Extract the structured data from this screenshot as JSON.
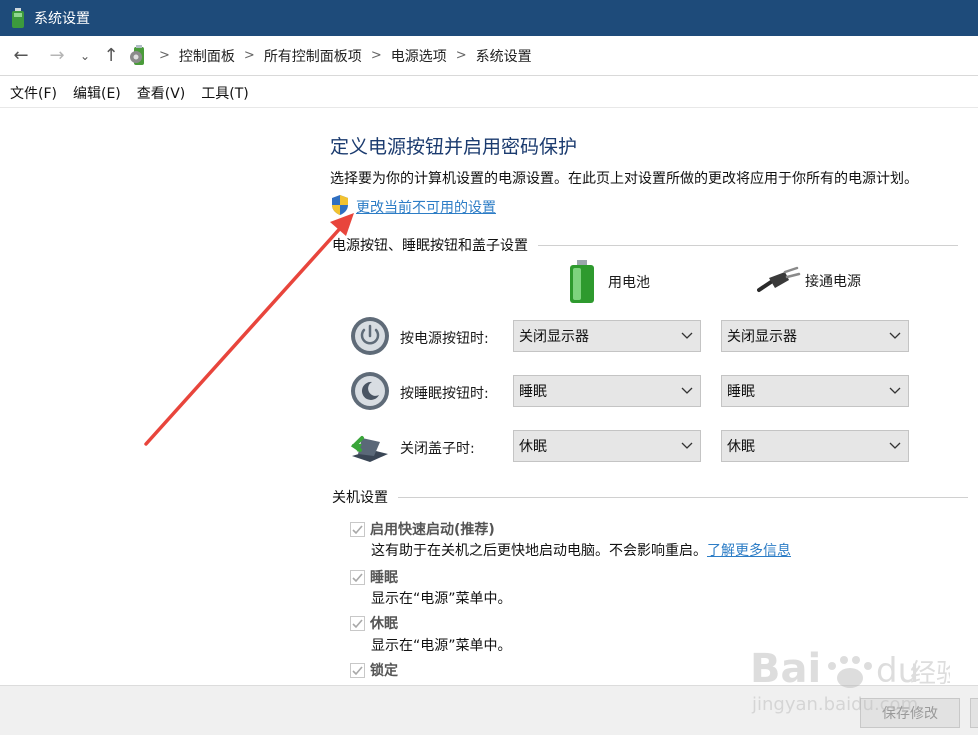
{
  "window": {
    "title": "系统设置"
  },
  "breadcrumb": [
    "控制面板",
    "所有控制面板项",
    "电源选项",
    "系统设置"
  ],
  "menu": [
    "文件(F)",
    "编辑(E)",
    "查看(V)",
    "工具(T)"
  ],
  "main": {
    "heading": "定义电源按钮并启用密码保护",
    "description": "选择要为你的计算机设置的电源设置。在此页上对设置所做的更改将应用于你所有的电源计划。",
    "change_link": "更改当前不可用的设置",
    "buttons_section": "电源按钮、睡眠按钮和盖子设置",
    "col_battery": "用电池",
    "col_plugged": "接通电源",
    "rows": [
      {
        "label": "按电源按钮时:",
        "battery": "关闭显示器",
        "plugged": "关闭显示器"
      },
      {
        "label": "按睡眠按钮时:",
        "battery": "睡眠",
        "plugged": "睡眠"
      },
      {
        "label": "关闭盖子时:",
        "battery": "休眠",
        "plugged": "休眠"
      }
    ],
    "shutdown_section": "关机设置",
    "options": [
      {
        "label": "启用快速启动(推荐)",
        "desc": "这有助于在关机之后更快地启动电脑。不会影响重启。",
        "link": "了解更多信息",
        "checked": true
      },
      {
        "label": "睡眠",
        "desc": "显示在“电源”菜单中。",
        "checked": true
      },
      {
        "label": "休眠",
        "desc": "显示在“电源”菜单中。",
        "checked": true
      },
      {
        "label": "锁定",
        "checked": true
      }
    ]
  },
  "footer": {
    "save": "保存修改"
  },
  "watermark": {
    "brand": "Bai",
    "brand2": "du",
    "cn": "经验",
    "url": "jingyan.baidu.com"
  },
  "colors": {
    "titlebar": "#1e4b7a",
    "link": "#2d7dc6",
    "heading": "#1b3b6f",
    "arrow": "#e8453c"
  }
}
